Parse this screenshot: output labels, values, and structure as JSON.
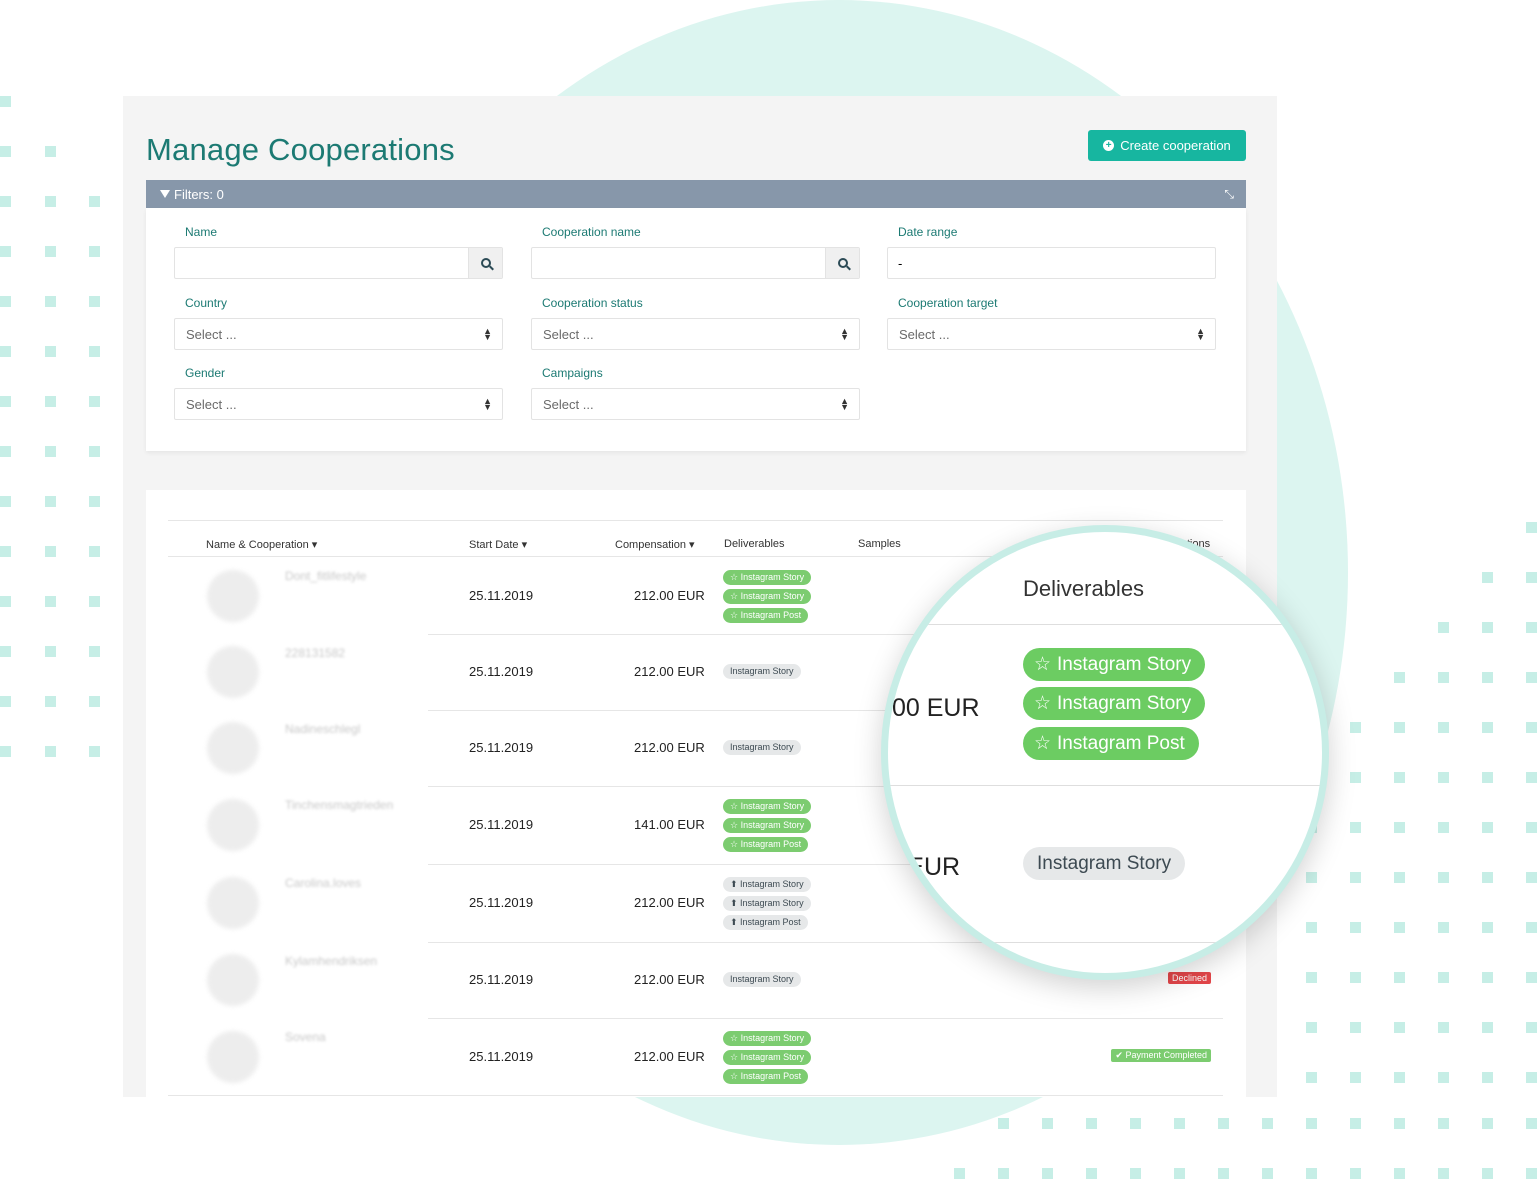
{
  "page": {
    "title": "Manage Cooperations",
    "create_label": "Create cooperation"
  },
  "filters": {
    "bar_label": "Filters: 0",
    "name_label": "Name",
    "coop_name_label": "Cooperation name",
    "date_range_label": "Date range",
    "date_range_value": "-",
    "country_label": "Country",
    "coop_status_label": "Cooperation status",
    "coop_target_label": "Cooperation target",
    "gender_label": "Gender",
    "campaigns_label": "Campaigns",
    "select_placeholder": "Select ..."
  },
  "table": {
    "headers": {
      "name": "Name & Cooperation ▾",
      "start": "Start Date ▾",
      "comp": "Compensation ▾",
      "deliverables": "Deliverables",
      "samples": "Samples",
      "actions": "Actions"
    },
    "rows": [
      {
        "name": "Dont_fitlifestyle",
        "date": "25.11.2019",
        "comp": "212.00 EUR",
        "deliverables": [
          "Instagram Story",
          "Instagram Story",
          "Instagram Post"
        ],
        "style": "green-star"
      },
      {
        "name": "228131582",
        "date": "25.11.2019",
        "comp": "212.00 EUR",
        "deliverables": [
          "Instagram Story"
        ],
        "style": "gray"
      },
      {
        "name": "Nadineschlegl",
        "date": "25.11.2019",
        "comp": "212.00 EUR",
        "deliverables": [
          "Instagram Story"
        ],
        "style": "gray"
      },
      {
        "name": "Tinchensmagtrieden",
        "date": "25.11.2019",
        "comp": "141.00 EUR",
        "deliverables": [
          "Instagram Story",
          "Instagram Story",
          "Instagram Post"
        ],
        "style": "green-star"
      },
      {
        "name": "Carolina.loves",
        "date": "25.11.2019",
        "comp": "212.00 EUR",
        "deliverables": [
          "Instagram Story",
          "Instagram Story",
          "Instagram Post"
        ],
        "style": "gray-upload"
      },
      {
        "name": "Kylamhendriksen",
        "date": "25.11.2019",
        "comp": "212.00 EUR",
        "deliverables": [
          "Instagram Story"
        ],
        "style": "gray",
        "status": "Declined",
        "status_color": "red"
      },
      {
        "name": "Sovena",
        "date": "25.11.2019",
        "comp": "212.00 EUR",
        "deliverables": [
          "Instagram Story",
          "Instagram Story",
          "Instagram Post"
        ],
        "style": "green-star",
        "status": "✔ Payment Completed",
        "status_color": "green"
      }
    ]
  },
  "zoom": {
    "header": "Deliverables",
    "eur_1": "00 EUR",
    "eur_2": ") EUR",
    "pills": [
      "Instagram Story",
      "Instagram Story",
      "Instagram Post"
    ],
    "gray_pill": "Instagram Story"
  },
  "colors": {
    "accent": "#17b6a0",
    "title": "#1c7a73",
    "filters_bar": "#8797aa",
    "pill_green": "#7ccc70",
    "declined": "#e4464a",
    "bg_circle": "#dcf5f0"
  }
}
